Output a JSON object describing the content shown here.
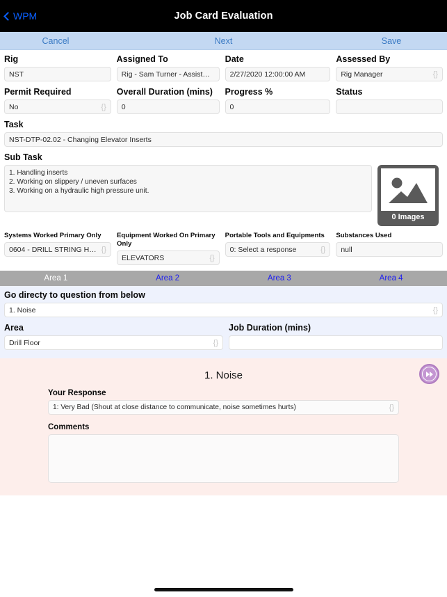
{
  "navbar": {
    "back_label": "WPM",
    "title": "Job Card Evaluation"
  },
  "toolbar": {
    "cancel_label": "Cancel",
    "next_label": "Next",
    "save_label": "Save"
  },
  "form": {
    "row1": [
      {
        "label": "Rig",
        "value": "NST",
        "picker": ""
      },
      {
        "label": "Assigned To",
        "value": "Rig - Sam Turner - Assistant Rig...",
        "picker": ""
      },
      {
        "label": "Date",
        "value": "2/27/2020 12:00:00 AM",
        "picker": ""
      },
      {
        "label": "Assessed By",
        "value": "Rig Manager",
        "picker": "{}"
      }
    ],
    "row2": [
      {
        "label": "Permit Required",
        "value": "No",
        "picker": "{}"
      },
      {
        "label": "Overall Duration (mins)",
        "value": "0",
        "picker": ""
      },
      {
        "label": "Progress %",
        "value": "0",
        "picker": ""
      },
      {
        "label": "Status",
        "value": "",
        "picker": ""
      }
    ],
    "task": {
      "label": "Task",
      "value": "NST-DTP-02.02 - Changing Elevator Inserts"
    },
    "subtask": {
      "label": "Sub Task",
      "value": "1. Handling inserts\n2. Working on slippery / uneven surfaces\n3. Working on a hydraulic high pressure unit."
    },
    "images": {
      "count_label": "0 Images"
    },
    "row3": [
      {
        "label": "Systems Worked Primary Only",
        "value": "0604 - DRILL STRING HANDLI...",
        "picker": "{}"
      },
      {
        "label": "Equipment Worked On Primary Only",
        "value": "ELEVATORS",
        "picker": "{}"
      },
      {
        "label": "Portable Tools and Equipments",
        "value": "0: Select a response",
        "picker": "{}"
      },
      {
        "label": "Substances Used",
        "value": "null",
        "picker": ""
      }
    ]
  },
  "area_tabs": [
    {
      "label": "Area 1",
      "active": true
    },
    {
      "label": "Area 2",
      "active": false
    },
    {
      "label": "Area 3",
      "active": false
    },
    {
      "label": "Area 4",
      "active": false
    }
  ],
  "jump": {
    "label": "Go directy to question from below",
    "value": "1. Noise",
    "picker": "{}"
  },
  "area_row": {
    "area": {
      "label": "Area",
      "value": "Drill Floor",
      "picker": "{}"
    },
    "duration": {
      "label": "Job Duration (mins)",
      "value": "",
      "picker": ""
    }
  },
  "question": {
    "title": "1. Noise",
    "next_icon": "fast-forward-icon",
    "response_label": "Your Response",
    "response_value": "1: Very Bad (Shout at close distance to communicate, noise sometimes hurts)",
    "response_picker": "{}",
    "comments_label": "Comments",
    "comments_value": ""
  },
  "colors": {
    "navbar_bg": "#000000",
    "toolbar_bg": "#c3d8f2",
    "link_blue": "#3a7ac4",
    "tab_bar_bg": "#a8a8a8",
    "tab_link": "#2020ee",
    "section_blue": "#eef2fd",
    "section_pink": "#fdeeeb",
    "accent_purple": "#c496d2"
  }
}
